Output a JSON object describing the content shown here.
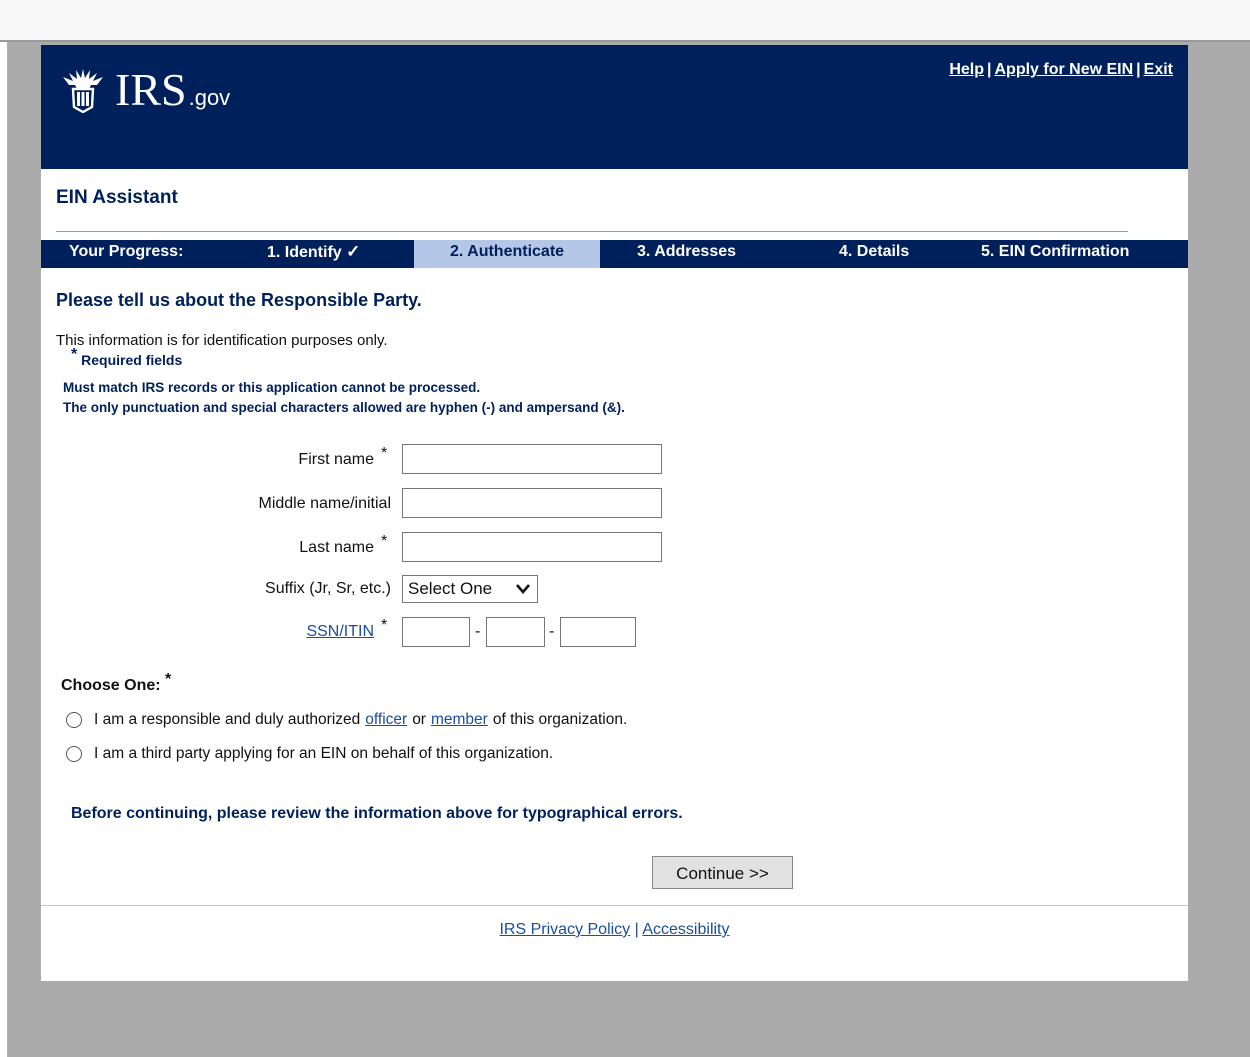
{
  "header": {
    "logo_main": "IRS",
    "logo_suffix": ".gov",
    "links": {
      "help": "Help",
      "apply": "Apply for New EIN",
      "exit": "Exit",
      "separator": "|"
    }
  },
  "app_title": "EIN Assistant",
  "progress": {
    "label": "Your Progress:",
    "steps": [
      {
        "label": "1. Identify",
        "status": "complete",
        "check": "✓"
      },
      {
        "label": "2. Authenticate",
        "status": "current"
      },
      {
        "label": "3. Addresses",
        "status": "upcoming"
      },
      {
        "label": "4. Details",
        "status": "upcoming"
      },
      {
        "label": "5. EIN Confirmation",
        "status": "upcoming"
      }
    ]
  },
  "form": {
    "heading": "Please tell us about the Responsible Party.",
    "info": "This information is for identification purposes only.",
    "required_star": "*",
    "required_note": "Required fields",
    "notes": [
      "Must match IRS records or this application cannot be processed.",
      "The only punctuation and special characters allowed are hyphen (-) and ampersand (&)."
    ],
    "fields": {
      "first_name": {
        "label": "First name",
        "value": ""
      },
      "middle_name": {
        "label": "Middle name/initial",
        "value": ""
      },
      "last_name": {
        "label": "Last name",
        "value": ""
      },
      "suffix": {
        "label": "Suffix (Jr, Sr, etc.)",
        "selected": "Select One"
      },
      "ssn": {
        "label": "SSN/ITIN",
        "separator": "-",
        "part1": "",
        "part2": "",
        "part3": ""
      }
    },
    "choose_one": {
      "label": "Choose One:",
      "option1": {
        "before": "I am a responsible and duly authorized",
        "link1": "officer",
        "middle": "or",
        "link2": "member",
        "after": "of this organization."
      },
      "option2": {
        "text": "I am a third party applying for an EIN on behalf of this organization."
      }
    },
    "review_note": "Before continuing, please review the information above for typographical errors.",
    "continue_label": "Continue >>"
  },
  "footer": {
    "privacy": "IRS Privacy Policy",
    "separator": "|",
    "accessibility": "Accessibility"
  },
  "colors": {
    "navy": "#00205b",
    "progress_active": "#b4c7e7",
    "link": "#1b4d9c",
    "outer_background": "#ababab"
  },
  "icons": [
    "eagle-seal-icon",
    "checkmark-icon",
    "chevron-down-icon",
    "radio-icon"
  ]
}
